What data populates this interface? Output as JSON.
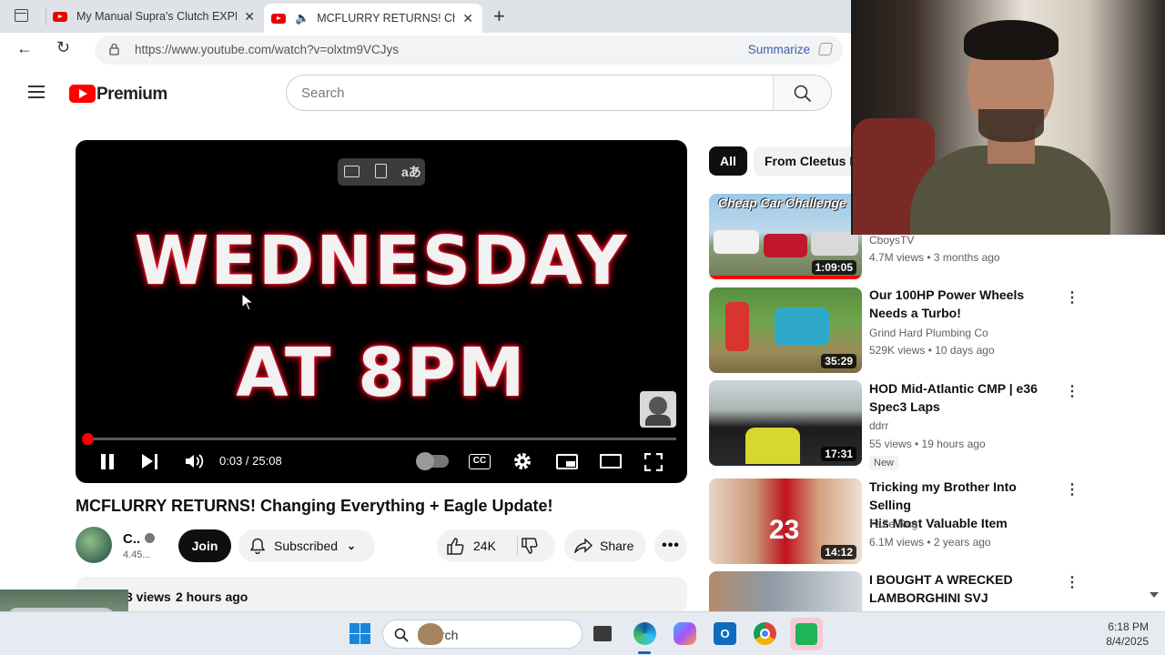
{
  "browser": {
    "tabs": [
      {
        "title": "My Manual Supra's Clutch EXPLODED"
      },
      {
        "title": "MCFLURRY RETURNS! Changing Everything"
      }
    ],
    "url": "https://www.youtube.com/watch?v=olxtm9VCJys",
    "summarize_label": "Summarize"
  },
  "youtube": {
    "logo_text": "Premium",
    "search_placeholder": "Search"
  },
  "player": {
    "overlay_line1": "WEDNESDAY",
    "overlay_line2": "AT 8PM",
    "time": "0:03 / 25:08",
    "progress_fraction": 0.002,
    "cc_label": "CC"
  },
  "video": {
    "title": "MCFLURRY RETURNS! Changing Everything + Eagle Update!",
    "channel_name": "C..",
    "subscriber_count": "4.45...",
    "join_label": "Join",
    "subscribed_label": "Subscribed",
    "likes": "24K",
    "share_label": "Share",
    "views": "3 views",
    "posted": "2 hours ago"
  },
  "sidebar": {
    "chips": [
      "All",
      "From Cleetus M"
    ],
    "items": [
      {
        "thumb_text": "Cheap Car Challenge",
        "duration": "1:09:05",
        "channel": "CboysTV",
        "meta": "4.7M views • 3 months ago"
      },
      {
        "title_line1": "Our 100HP Power Wheels",
        "title_line2": "Needs a Turbo!",
        "duration": "35:29",
        "channel": "Grind Hard Plumbing Co",
        "meta": "529K views • 10 days ago"
      },
      {
        "title_line1": "HOD Mid-Atlantic CMP | e36",
        "title_line2": "Spec3 Laps",
        "duration": "17:31",
        "channel": "ddrr",
        "meta": "55 views • 19 hours ago",
        "badge": "New"
      },
      {
        "title_line1": "Tricking my Brother Into Selling",
        "title_line2": "His Most Valuable Item",
        "duration": "14:12",
        "channel": "FaZe Rug",
        "meta": "6.1M views • 2 years ago"
      },
      {
        "title_line1": "I BOUGHT A WRECKED",
        "title_line2": "LAMBORGHINI SVJ"
      }
    ]
  },
  "taskbar": {
    "search_label": "Search",
    "time": "6:18 PM",
    "date": "8/4/2025"
  },
  "colors": {
    "youtube_red": "#ff0000",
    "player_bg": "#000000",
    "chip_active": "#0f0f0f",
    "taskbar": "#e6ebf2"
  }
}
